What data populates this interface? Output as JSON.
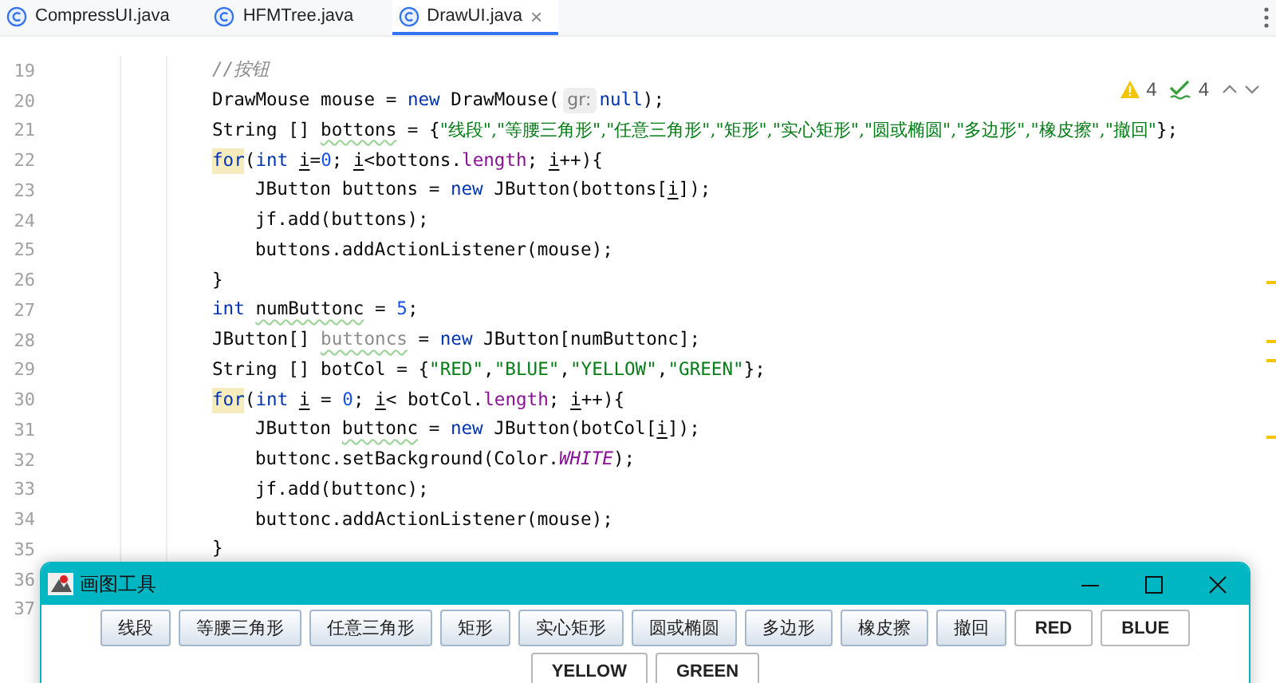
{
  "tabs": [
    {
      "label": "CompressUI.java",
      "selected": false
    },
    {
      "label": "HFMTree.java",
      "selected": false
    },
    {
      "label": "DrawUI.java",
      "selected": true,
      "close": "×"
    }
  ],
  "inspections": {
    "warnings": "4",
    "weak_warnings": "4"
  },
  "editor": {
    "lines": [
      {
        "number": "19",
        "tokens": [
          {
            "kind": "comment",
            "text": "//按钮"
          }
        ]
      },
      {
        "number": "20",
        "tokens": [
          {
            "kind": "plain",
            "text": "DrawMouse mouse = "
          },
          {
            "kind": "keyword",
            "text": "new"
          },
          {
            "kind": "plain",
            "text": " DrawMouse("
          },
          {
            "kind": "hint",
            "text": "gr:"
          },
          {
            "kind": "keyword",
            "text": "null"
          },
          {
            "kind": "plain",
            "text": ");"
          }
        ]
      },
      {
        "number": "21",
        "tokens": [
          {
            "kind": "plain",
            "text": "String [] "
          },
          {
            "kind": "warn",
            "text": "bottons"
          },
          {
            "kind": "plain",
            "text": " = {"
          },
          {
            "kind": "string",
            "text": "\"线段\","
          },
          {
            "kind": "string",
            "text": "\"等腰三角形\","
          },
          {
            "kind": "string",
            "text": "\"任意三角形\","
          },
          {
            "kind": "string",
            "text": "\"矩形\","
          },
          {
            "kind": "string",
            "text": "\"实心矩形\","
          },
          {
            "kind": "string",
            "text": "\"圆或椭圆\","
          },
          {
            "kind": "string",
            "text": "\"多边形\","
          },
          {
            "kind": "string",
            "text": "\"橡皮擦\","
          },
          {
            "kind": "string",
            "text": "\"撤回\""
          },
          {
            "kind": "plain",
            "text": "};"
          }
        ]
      },
      {
        "number": "22",
        "tokens": [
          {
            "kind": "marked",
            "text": "for"
          },
          {
            "kind": "plain",
            "text": "("
          },
          {
            "kind": "keyword",
            "text": "int "
          },
          {
            "kind": "var",
            "text": "i"
          },
          {
            "kind": "plain",
            "text": "="
          },
          {
            "kind": "number",
            "text": "0"
          },
          {
            "kind": "plain",
            "text": "; "
          },
          {
            "kind": "var",
            "text": "i"
          },
          {
            "kind": "plain",
            "text": "<bottons."
          },
          {
            "kind": "field",
            "text": "length"
          },
          {
            "kind": "plain",
            "text": "; "
          },
          {
            "kind": "var",
            "text": "i"
          },
          {
            "kind": "plain",
            "text": "++){"
          }
        ],
        "children": [
          {
            "number": "23",
            "tokens": [
              {
                "kind": "plain",
                "text": "JButton buttons = "
              },
              {
                "kind": "keyword",
                "text": "new"
              },
              {
                "kind": "plain",
                "text": " JButton(bottons["
              },
              {
                "kind": "var",
                "text": "i"
              },
              {
                "kind": "plain",
                "text": "]);"
              }
            ]
          },
          {
            "number": "24",
            "tokens": [
              {
                "kind": "plain",
                "text": "jf.add(buttons);"
              }
            ]
          },
          {
            "number": "25",
            "tokens": [
              {
                "kind": "plain",
                "text": "buttons.addActionListener(mouse);"
              }
            ]
          }
        ]
      },
      {
        "number": "26",
        "tokens": [
          {
            "kind": "plain",
            "text": "}"
          }
        ]
      },
      {
        "number": "27",
        "tokens": [
          {
            "kind": "keyword",
            "text": "int "
          },
          {
            "kind": "warn",
            "text": "numButtonc"
          },
          {
            "kind": "plain",
            "text": " = "
          },
          {
            "kind": "number",
            "text": "5"
          },
          {
            "kind": "plain",
            "text": ";"
          }
        ]
      },
      {
        "number": "28",
        "tokens": [
          {
            "kind": "plain",
            "text": "JButton[] "
          },
          {
            "kind": "unused",
            "text": "buttoncs"
          },
          {
            "kind": "plain",
            "text": " = "
          },
          {
            "kind": "keyword",
            "text": "new"
          },
          {
            "kind": "plain",
            "text": " JButton[numButtonc];"
          }
        ]
      },
      {
        "number": "29",
        "tokens": [
          {
            "kind": "plain",
            "text": "String [] botCol = {"
          },
          {
            "kind": "string",
            "text": "\"RED\""
          },
          {
            "kind": "plain",
            "text": ","
          },
          {
            "kind": "string",
            "text": "\"BLUE\""
          },
          {
            "kind": "plain",
            "text": ","
          },
          {
            "kind": "string",
            "text": "\"YELLOW\""
          },
          {
            "kind": "plain",
            "text": ","
          },
          {
            "kind": "string",
            "text": "\"GREEN\""
          },
          {
            "kind": "plain",
            "text": "};"
          }
        ]
      },
      {
        "number": "30",
        "tokens": [
          {
            "kind": "marked",
            "text": "for"
          },
          {
            "kind": "plain",
            "text": "("
          },
          {
            "kind": "keyword",
            "text": "int "
          },
          {
            "kind": "var",
            "text": "i"
          },
          {
            "kind": "plain",
            "text": " = "
          },
          {
            "kind": "number",
            "text": "0"
          },
          {
            "kind": "plain",
            "text": "; "
          },
          {
            "kind": "var",
            "text": "i"
          },
          {
            "kind": "plain",
            "text": "< botCol."
          },
          {
            "kind": "field",
            "text": "length"
          },
          {
            "kind": "plain",
            "text": "; "
          },
          {
            "kind": "var",
            "text": "i"
          },
          {
            "kind": "plain",
            "text": "++){"
          }
        ],
        "children": [
          {
            "number": "31",
            "tokens": [
              {
                "kind": "plain",
                "text": "JButton "
              },
              {
                "kind": "warn",
                "text": "buttonc"
              },
              {
                "kind": "plain",
                "text": " = "
              },
              {
                "kind": "keyword",
                "text": "new"
              },
              {
                "kind": "plain",
                "text": " JButton(botCol["
              },
              {
                "kind": "var",
                "text": "i"
              },
              {
                "kind": "plain",
                "text": "]);"
              }
            ]
          },
          {
            "number": "32",
            "tokens": [
              {
                "kind": "plain",
                "text": "buttonc.setBackground(Color."
              },
              {
                "kind": "constant",
                "text": "WHITE"
              },
              {
                "kind": "plain",
                "text": ");"
              }
            ]
          },
          {
            "number": "33",
            "tokens": [
              {
                "kind": "plain",
                "text": "jf.add(buttonc);"
              }
            ]
          },
          {
            "number": "34",
            "tokens": [
              {
                "kind": "plain",
                "text": "buttonc.addActionListener(mouse);"
              }
            ]
          }
        ]
      },
      {
        "number": "35",
        "tokens": [
          {
            "kind": "plain",
            "text": "}"
          }
        ]
      },
      {
        "number": "36"
      },
      {
        "number": "37"
      }
    ]
  },
  "app_window": {
    "title": "画图工具",
    "buttons": [
      {
        "kind": "shape",
        "label": "线段"
      },
      {
        "kind": "shape",
        "label": "等腰三角形"
      },
      {
        "kind": "shape",
        "label": "任意三角形"
      },
      {
        "kind": "shape",
        "label": "矩形"
      },
      {
        "kind": "shape",
        "label": "实心矩形"
      },
      {
        "kind": "shape",
        "label": "圆或椭圆"
      },
      {
        "kind": "shape",
        "label": "多边形"
      },
      {
        "kind": "shape",
        "label": "橡皮擦"
      },
      {
        "kind": "shape",
        "label": "撤回"
      },
      {
        "kind": "color",
        "label": "RED"
      },
      {
        "kind": "color",
        "label": "BLUE"
      },
      {
        "kind": "color",
        "label": "YELLOW"
      },
      {
        "kind": "color",
        "label": "GREEN"
      }
    ]
  }
}
